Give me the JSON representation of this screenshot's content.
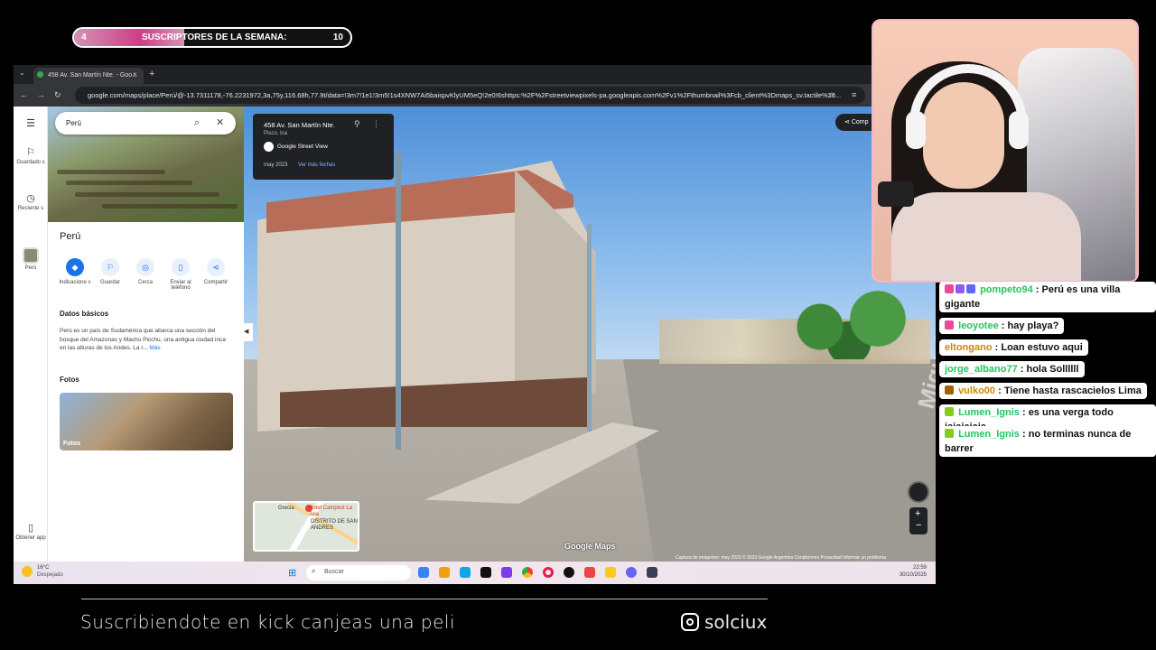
{
  "overlay": {
    "sub_goal": {
      "start": "4",
      "label": "SUSCRIPTORES DE LA SEMANA:",
      "target": "10",
      "progress_fraction": 0.4
    },
    "footer": {
      "text": "Suscribiendote en kick canjeas una peli",
      "instagram_handle": "solciux"
    },
    "accent_color": "#f4b6c9"
  },
  "browser": {
    "tab_title": "458 Av. San Martín Nte. - Goo...",
    "tab_close": "×",
    "new_tab": "+",
    "url": "google.com/maps/place/Perú/@-13.7311178,-76.2231972,3a,75y,116.68h,77.9t/data=!3m7!1e1!3m5!1s4XNW7Ai5baispvKlyUM5eQ!2e0!6shttps:%2F%2Fstreetviewpixels-pa.googleapis.com%2Fv1%2Fthumbnail%3Fcb_client%3Dmaps_sv.tactile%26..."
  },
  "maps": {
    "rail": [
      {
        "icon": "menu-icon",
        "label": ""
      },
      {
        "icon": "bookmark-icon",
        "label": "Guardado s"
      },
      {
        "icon": "history-icon",
        "label": "Reciente s"
      },
      {
        "icon": "peru-thumb",
        "label": "Perú"
      },
      {
        "icon": "phone-icon",
        "label": "Obtener app"
      }
    ],
    "search_value": "Perú",
    "place_title": "Perú",
    "actions": [
      {
        "icon": "directions-icon",
        "label": "Indicacione s"
      },
      {
        "icon": "save-icon",
        "label": "Guardar"
      },
      {
        "icon": "nearby-icon",
        "label": "Cerca"
      },
      {
        "icon": "send-to-phone-icon",
        "label": "Enviar al teléfono"
      },
      {
        "icon": "share-icon",
        "label": "Compartir"
      }
    ],
    "basic_info_title": "Datos básicos",
    "basic_info_text": "Perú es un país de Sudamérica que abarca una sección del bosque del Amazonas y Machu Picchu, una antigua ciudad inca en las alturas de los Andes. La r...",
    "basic_info_more": "Más",
    "photos_title": "Fotos",
    "photos_caption": "Fotos"
  },
  "street_view": {
    "address": "458 Av. San Martín Nte.",
    "city": "Pisco, Ica",
    "source": "Google Street View",
    "date": "may 2023",
    "more_dates": "Ver más fechas",
    "share_label": "Comp",
    "watermark": "Google Maps",
    "copyright": "Captura de imágenes: may 2023   © 2023 Google   Argentina   Condiciones   Privacidad   Informar un problema",
    "street_paint": "Miguel Grau",
    "minimap": {
      "label_hotel": "Hotel Campest La Jala",
      "label_district": "DISTRITO DE SAN ANDRES",
      "label_grecia": "Grecia"
    },
    "zoom_in": "+",
    "zoom_out": "−"
  },
  "taskbar": {
    "weather_temp": "16°C",
    "weather_desc": "Despejado",
    "search_placeholder": "Buscar",
    "time": "22:59",
    "date": "30/10/2025",
    "apps": [
      "file-explorer",
      "folder",
      "store",
      "tiktok",
      "app-purple",
      "chrome",
      "opera",
      "game",
      "youtube",
      "app-yellow",
      "discord",
      "app-dark"
    ]
  },
  "chat": [
    {
      "user": "pompeto94",
      "user_color": "#22c55e",
      "badges": [
        "#ec4899",
        "#8b5cf6",
        "#6366f1"
      ],
      "message": "Perú es una villa gigante"
    },
    {
      "user": "leoyotee",
      "user_color": "#22c55e",
      "badges": [
        "#ec4899"
      ],
      "message": "hay playa?"
    },
    {
      "user": "eltongano",
      "user_color": "#ca8a04",
      "badges": [],
      "message": "Loan estuvo aqui"
    },
    {
      "user": "jorge_albano77",
      "user_color": "#22c55e",
      "badges": [],
      "message": "hola Sollllll"
    },
    {
      "user": "vulko00",
      "user_color": "#ca8a04",
      "badges": [
        "#a16207"
      ],
      "message": "Tiene hasta rascacielos Lima"
    },
    {
      "user": "Lumen_Ignis",
      "user_color": "#22c55e",
      "badges": [
        "#84cc16"
      ],
      "message": "es una verga todo jajajajaja"
    },
    {
      "user": "Lumen_Ignis",
      "user_color": "#22c55e",
      "badges": [
        "#84cc16"
      ],
      "message": "no terminas nunca de barrer"
    }
  ]
}
